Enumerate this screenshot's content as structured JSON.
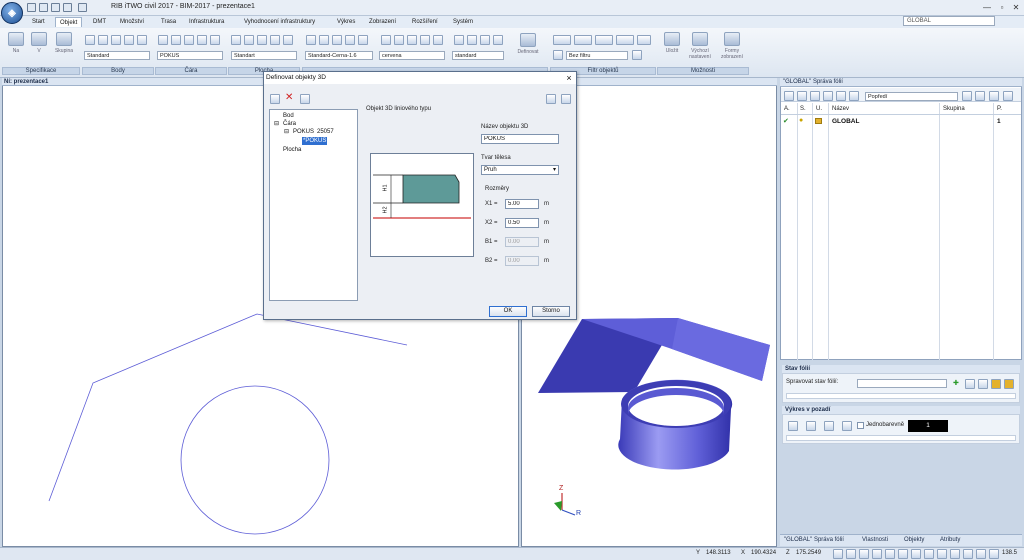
{
  "window": {
    "title": "RIB iTWO civil 2017 - BIM-2017 - prezentace1",
    "workspace": "GLOBAL",
    "controls": [
      "—",
      "▫",
      "✕"
    ]
  },
  "menu": [
    {
      "label": "Start"
    },
    {
      "label": "Objekt"
    },
    {
      "label": "DMT"
    },
    {
      "label": "Množství"
    },
    {
      "label": "Trasa"
    },
    {
      "label": "Infrastruktura"
    },
    {
      "label": "Vyhodnocení infrastruktury"
    },
    {
      "label": "Výkres"
    },
    {
      "label": "Zobrazení"
    },
    {
      "label": "Rozšíření"
    },
    {
      "label": "Systém"
    }
  ],
  "ribbon": {
    "btn_na": "Na",
    "btn_v": "V",
    "btn_skupina": "Skupina",
    "combo_body": "Standard",
    "combo_cara": "POKUS",
    "combo_plocha": "Standart",
    "combo_teleso": "Standard-Cerna-1.6",
    "combo_barva": "cervena",
    "combo_std": "standard",
    "btn_definovat": "Definovat",
    "combo_filtr": "Bez filtru",
    "btn_ulozit": "Uložit",
    "btn_vychozi": "Výchozí nastavení",
    "btn_formy": "Formy zobrazení",
    "groups": {
      "specifikace": "Specifikace",
      "body": "Body",
      "cara": "Čára",
      "plocha": "Plocha",
      "filtr": "Filtr objektů",
      "moznosti": "Možnosti"
    }
  },
  "views": {
    "left_tab": "Ní: prezentace1"
  },
  "axes": {
    "z": "Z",
    "r": "R"
  },
  "panel": {
    "title": "\"GLOBAL\"  Správa fólií",
    "view_combo": "Popředí",
    "headers": {
      "a": "A.",
      "s": "S.",
      "u": "U.",
      "nazev": "Název",
      "skupina": "Skupina",
      "p": "P."
    },
    "rows": [
      {
        "nazev": "GLOBAL",
        "p": "1"
      }
    ],
    "stav_title": "Stav fólií",
    "stav_label": "Spravovat stav fólií:",
    "vykres_title": "Výkres v pozadí",
    "jednobarevne": "Jednobarevně",
    "color_value": "1",
    "tabs": [
      "\"GLOBAL\" Správa fólií",
      "Vlastnosti",
      "Objekty",
      "Atributy"
    ]
  },
  "status": {
    "y_label": "Y",
    "y": "148.3113",
    "x_label": "X",
    "x": "190.4324",
    "z_label": "Z",
    "z": "175.2549",
    "zoom": "138.5"
  },
  "dialog": {
    "title": "Definovat objekty 3D",
    "tree": {
      "bod": "Bod",
      "cara": "Čára",
      "pokus": "POKUS",
      "pokus_num": "25057",
      "pokus_child": "*POKUS",
      "plocha": "Plocha"
    },
    "section_label": "Objekt 3D liniového typu",
    "name_label": "Název objektu 3D",
    "name_value": "POKUS",
    "shape_label": "Tvar tělesa",
    "shape_value": "Pruh",
    "dims_label": "Rozměry",
    "dims": [
      {
        "label": "X1 =",
        "value": "5.00",
        "unit": "m",
        "enabled": true
      },
      {
        "label": "X2 =",
        "value": "0.50",
        "unit": "m",
        "enabled": true
      },
      {
        "label": "B1 =",
        "value": "0.00",
        "unit": "m",
        "enabled": false
      },
      {
        "label": "B2 =",
        "value": "0.00",
        "unit": "m",
        "enabled": false
      }
    ],
    "preview_labels": {
      "h1": "H1",
      "h2": "H2"
    },
    "ok": "OK",
    "cancel": "Storno"
  }
}
